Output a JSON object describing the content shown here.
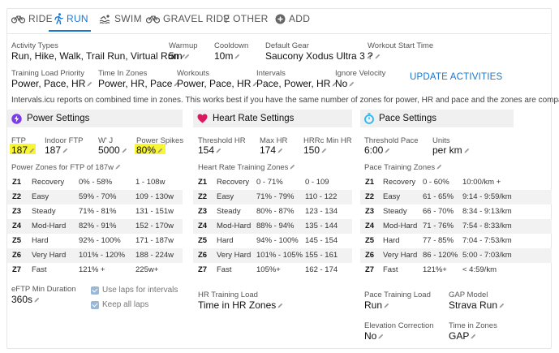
{
  "tabs": [
    {
      "label": "RIDE",
      "icon": "bike-icon"
    },
    {
      "label": "RUN",
      "icon": "run-icon"
    },
    {
      "label": "SWIM",
      "icon": "swim-icon"
    },
    {
      "label": "GRAVEL RIDE",
      "icon": "bike-icon"
    },
    {
      "label": "OTHER",
      "icon": "question-icon"
    },
    {
      "label": "ADD",
      "icon": "plus-circle-icon"
    }
  ],
  "active_tab": "RUN",
  "accent_color": "#1976d2",
  "settings": {
    "activity_types": {
      "label": "Activity Types",
      "value": "Run, Hike, Walk, Trail Run, Virtual Run"
    },
    "warmup": {
      "label": "Warmup",
      "value": "5m"
    },
    "cooldown": {
      "label": "Cooldown",
      "value": "10m"
    },
    "default_gear": {
      "label": "Default Gear",
      "value": "Saucony Xodus Ultra 3"
    },
    "workout_start_time": {
      "label": "Workout Start Time",
      "value": "?"
    },
    "training_load_priority": {
      "label": "Training Load Priority",
      "value": "Power, Pace, HR"
    },
    "time_in_zones": {
      "label": "Time In Zones",
      "value": "Power, HR, Pace"
    },
    "workouts": {
      "label": "Workouts",
      "value": "Power, Pace, HR"
    },
    "intervals": {
      "label": "Intervals",
      "value": "Pace, Power, HR"
    },
    "ignore_velocity": {
      "label": "Ignore Velocity",
      "value": "No"
    },
    "update_button": "UPDATE ACTIVITIES",
    "info_text": "Intervals.icu reports on combined time in zones. This works best if you have the same number of zones for power, HR and pace and the zones are comparable."
  },
  "power": {
    "title": "Power Settings",
    "ftp": {
      "label": "FTP",
      "value": "187"
    },
    "indoor_ftp": {
      "label": "Indoor FTP",
      "value": "187"
    },
    "wj": {
      "label": "W' J",
      "value": "5000"
    },
    "power_spikes": {
      "label": "Power Spikes",
      "value": "80%"
    },
    "zones_title": "Power Zones for FTP of 187w",
    "zones": [
      {
        "z": "Z1",
        "name": "Recovery",
        "pct": "0% - 58%",
        "range": "1 - 108w"
      },
      {
        "z": "Z2",
        "name": "Easy",
        "pct": "59% - 70%",
        "range": "109 - 130w"
      },
      {
        "z": "Z3",
        "name": "Steady",
        "pct": "71% - 81%",
        "range": "131 - 151w"
      },
      {
        "z": "Z4",
        "name": "Mod-Hard",
        "pct": "82% - 91%",
        "range": "152 - 170w"
      },
      {
        "z": "Z5",
        "name": "Hard",
        "pct": "92% - 100%",
        "range": "171 - 187w"
      },
      {
        "z": "Z6",
        "name": "Very Hard",
        "pct": "101% - 120%",
        "range": "188 - 224w"
      },
      {
        "z": "Z7",
        "name": "Fast",
        "pct": "121% +",
        "range": "225w+"
      }
    ],
    "eftp_min_duration": {
      "label": "eFTP Min Duration",
      "value": "360s"
    },
    "use_laps": "Use laps for intervals",
    "keep_laps": "Keep all laps"
  },
  "hr": {
    "title": "Heart Rate Settings",
    "threshold_hr": {
      "label": "Threshold HR",
      "value": "154"
    },
    "max_hr": {
      "label": "Max HR",
      "value": "174"
    },
    "hrrc_min_hr": {
      "label": "HRRc Min HR",
      "value": "150"
    },
    "zones_title": "Heart Rate Training Zones",
    "zones": [
      {
        "z": "Z1",
        "name": "Recovery",
        "pct": "0 - 71%",
        "range": "0 - 109"
      },
      {
        "z": "Z2",
        "name": "Easy",
        "pct": "71% - 79%",
        "range": "110 - 122"
      },
      {
        "z": "Z3",
        "name": "Steady",
        "pct": "80% - 87%",
        "range": "123 - 134"
      },
      {
        "z": "Z4",
        "name": "Mod-Hard",
        "pct": "88% - 94%",
        "range": "135 - 144"
      },
      {
        "z": "Z5",
        "name": "Hard",
        "pct": "94% - 100%",
        "range": "145 - 154"
      },
      {
        "z": "Z6",
        "name": "Very Hard",
        "pct": "101% - 105%",
        "range": "155 - 161"
      },
      {
        "z": "Z7",
        "name": "Fast",
        "pct": "105%+",
        "range": "162 - 174"
      }
    ],
    "hr_training_load": {
      "label": "HR Training Load",
      "value": "Time in HR Zones"
    }
  },
  "pace": {
    "title": "Pace Settings",
    "threshold_pace": {
      "label": "Threshold Pace",
      "value": "6:00"
    },
    "units": {
      "label": "Units",
      "value": "per km"
    },
    "zones_title": "Pace Training Zones",
    "zones": [
      {
        "z": "Z1",
        "name": "Recovery",
        "pct": "0 - 60%",
        "range": "10:00/km +"
      },
      {
        "z": "Z2",
        "name": "Easy",
        "pct": "61 - 65%",
        "range": "9:14 - 9:59/km"
      },
      {
        "z": "Z3",
        "name": "Steady",
        "pct": "66 - 70%",
        "range": "8:34 - 9:13/km"
      },
      {
        "z": "Z4",
        "name": "Mod-Hard",
        "pct": "71 - 76%",
        "range": "7:54 - 8:33/km"
      },
      {
        "z": "Z5",
        "name": "Hard",
        "pct": "77 - 85%",
        "range": "7:04 - 7:53/km"
      },
      {
        "z": "Z6",
        "name": "Very Hard",
        "pct": "86 - 120%",
        "range": "5:00 - 7:03/km"
      },
      {
        "z": "Z7",
        "name": "Fast",
        "pct": "121%+",
        "range": "< 4:59/km"
      }
    ],
    "pace_training_load": {
      "label": "Pace Training Load",
      "value": "Run"
    },
    "gap_model": {
      "label": "GAP Model",
      "value": "Strava Run"
    },
    "elevation_correction": {
      "label": "Elevation Correction",
      "value": "No"
    },
    "time_in_zones": {
      "label": "Time in Zones",
      "value": "GAP"
    }
  }
}
